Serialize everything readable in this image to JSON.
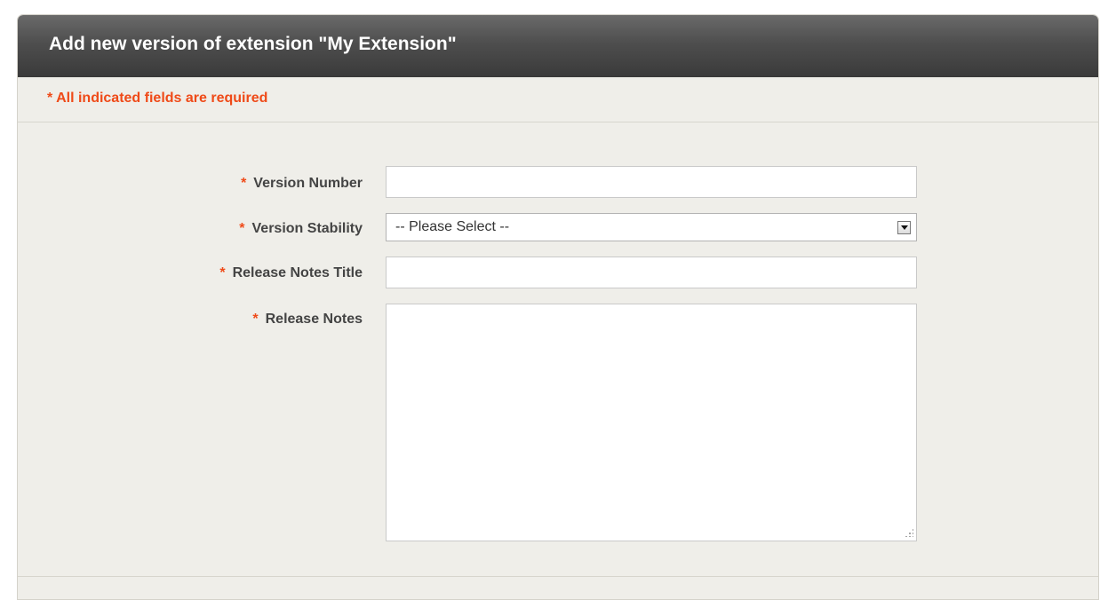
{
  "panel": {
    "title": "Add new version of extension \"My Extension\"",
    "required_note": "* All indicated fields are required"
  },
  "form": {
    "required_marker": "*",
    "fields": [
      {
        "label": "Version Number",
        "type": "text",
        "value": ""
      },
      {
        "label": "Version Stability",
        "type": "select",
        "value": "-- Please Select --"
      },
      {
        "label": "Release Notes Title",
        "type": "text",
        "value": ""
      },
      {
        "label": "Release Notes",
        "type": "textarea",
        "value": ""
      }
    ]
  },
  "colors": {
    "header_dark": "#3a3a3a",
    "panel_bg": "#efeee9",
    "required_accent": "#ef4a18"
  }
}
